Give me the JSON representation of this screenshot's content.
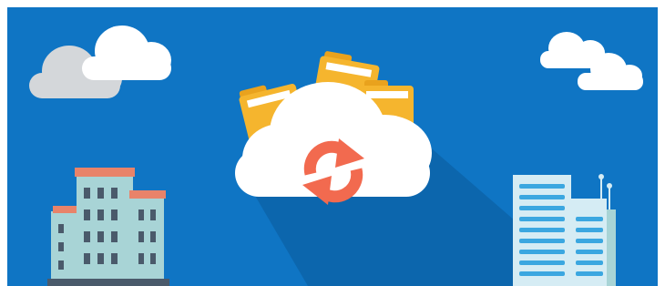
{
  "scene": {
    "subject": "cloud-file-sync",
    "colors": {
      "sky": "#0F75C4",
      "cloud_front": "#FFFFFF",
      "cloud_back": "#D4D7DA",
      "shadow": "#0B5A9A",
      "folder": "#F5B52E",
      "folder_back": "#E9A21D",
      "paper": "#FFFFFF",
      "sync": "#F26A4F",
      "building_left_wall": "#A8D4D6",
      "building_left_roof": "#E8836A",
      "building_left_window": "#4A5A6B",
      "building_right_wall": "#D5ECF4",
      "building_right_stripe": "#3BA7E0",
      "building_right_annex": "#A8D4D6"
    },
    "icons": [
      "cloud-icon",
      "folder-icon",
      "sync-icon",
      "office-building-icon",
      "skyscraper-icon"
    ]
  }
}
